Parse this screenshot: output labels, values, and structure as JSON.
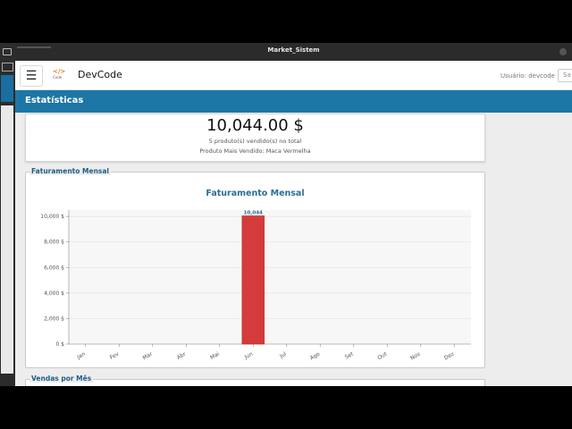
{
  "window": {
    "title": "Market_Sistem"
  },
  "appbar": {
    "menu_icon": "hamburger-icon",
    "logo_code": "</>",
    "logo_sub": "Code",
    "brand": "DevCode",
    "user_label": "Usuário: devcode",
    "logout_label": "Sa"
  },
  "section": {
    "title": "Estatísticas"
  },
  "stats": {
    "total": "10,044.00 $",
    "sold_text": "5 produto(s) vendido(s) no total",
    "best_text": "Produto Mais Vendido: Maca Vermelha"
  },
  "fieldsets": {
    "monthly_revenue": "Faturamento Mensal",
    "sales_per_month": "Vendas por Mês"
  },
  "chart_data": {
    "type": "bar",
    "title": "Faturamento Mensal",
    "categories": [
      "Jan",
      "Fev",
      "Mar",
      "Abr",
      "Mai",
      "Jun",
      "Jul",
      "Ago",
      "Set",
      "Out",
      "Nov",
      "Dez"
    ],
    "values": [
      0,
      0,
      0,
      0,
      0,
      10044,
      0,
      0,
      0,
      0,
      0,
      0
    ],
    "data_labels": {
      "Jun": "10,044"
    },
    "y_ticks": [
      "0 $",
      "2,000 $",
      "4,000 $",
      "6,000 $",
      "8,000 $",
      "10,000 $"
    ],
    "ylim": [
      0,
      10500
    ],
    "grid": true,
    "bar_color": "#d63b3b"
  }
}
